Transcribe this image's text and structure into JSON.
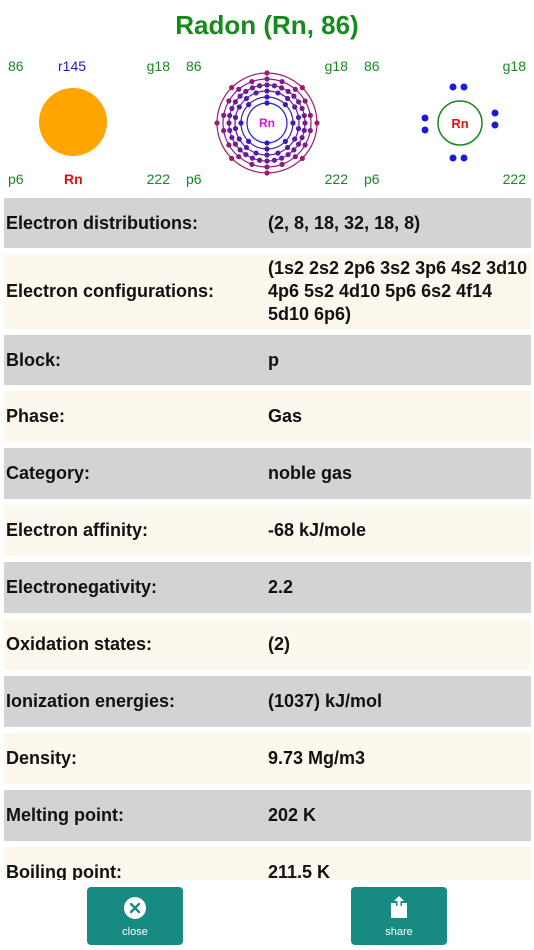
{
  "title": "Radon (Rn, 86)",
  "panels": {
    "atom": {
      "number": "86",
      "radius": "r145",
      "group": "g18",
      "period": "p6",
      "symbol": "Rn",
      "mass": "222"
    },
    "shells": {
      "number": "86",
      "group": "g18",
      "period": "p6",
      "mass": "222",
      "symbol": "Rn",
      "distribution": [
        2,
        8,
        18,
        32,
        18,
        8
      ]
    },
    "lewis": {
      "number": "86",
      "group": "g18",
      "period": "p6",
      "mass": "222",
      "symbol": "Rn",
      "valence_electrons": 8
    }
  },
  "properties": [
    {
      "label": "Electron distributions:",
      "value": "(2, 8, 18, 32, 18, 8)"
    },
    {
      "label": "Electron configurations:",
      "value": "(1s2 2s2 2p6 3s2 3p6 4s2 3d10 4p6 5s2 4d10 5p6 6s2 4f14 5d10 6p6)"
    },
    {
      "label": "Block:",
      "value": "p"
    },
    {
      "label": "Phase:",
      "value": "Gas"
    },
    {
      "label": "Category:",
      "value": "noble gas"
    },
    {
      "label": "Electron affinity:",
      "value": "-68 kJ/mole"
    },
    {
      "label": "Electronegativity:",
      "value": "2.2"
    },
    {
      "label": "Oxidation states:",
      "value": "(2)"
    },
    {
      "label": "Ionization energies:",
      "value": "(1037) kJ/mol"
    },
    {
      "label": "Density:",
      "value": "9.73 Mg/m3"
    },
    {
      "label": "Melting point:",
      "value": "202 K"
    },
    {
      "label": "Boiling point:",
      "value": "211.5 K"
    }
  ],
  "buttons": {
    "close": "close",
    "share": "share"
  },
  "colors": {
    "title": "#178a1e",
    "button": "#178a82",
    "atom": "#ffa500",
    "symbol": "#e01010",
    "radius": "#1a1ac8",
    "shell_symbol": "#e010e0"
  },
  "icons": {
    "close": "close-circle-icon",
    "share": "share-icon"
  }
}
